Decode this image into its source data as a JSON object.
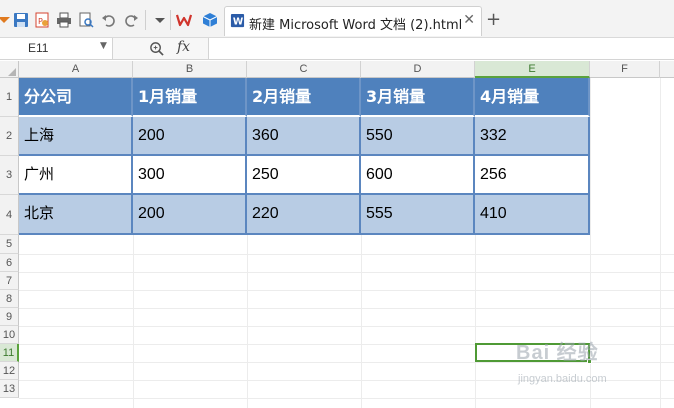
{
  "toolbar": {
    "document_tab_title": "新建 Microsoft Word 文档 (2).html",
    "close_label": "✕",
    "new_tab_label": "+"
  },
  "formula_bar": {
    "name_box": "E11",
    "fx_label": "fx",
    "formula": ""
  },
  "columns": [
    "A",
    "B",
    "C",
    "D",
    "E",
    "F"
  ],
  "rows": [
    "1",
    "2",
    "3",
    "4",
    "5",
    "6",
    "7",
    "8",
    "9",
    "10",
    "11",
    "12",
    "13"
  ],
  "active_cell": {
    "column": "E",
    "row": "11"
  },
  "table": {
    "headers": [
      "分公司",
      "1月销量",
      "2月销量",
      "3月销量",
      "4月销量"
    ],
    "rows": [
      [
        "上海",
        "200",
        "360",
        "550",
        "332"
      ],
      [
        "广州",
        "300",
        "250",
        "600",
        "256"
      ],
      [
        "北京",
        "200",
        "220",
        "555",
        "410"
      ]
    ]
  },
  "watermark": {
    "main": "Bai 经验",
    "sub": "jingyan.baidu.com"
  },
  "colors": {
    "header_fill": "#4f81bd",
    "band_fill": "#b8cce4",
    "border": "#5b86bf",
    "selection": "#4f9a35"
  },
  "icons": [
    "menu-arrow-icon",
    "save-icon",
    "pdf-export-icon",
    "print-icon",
    "print-preview-icon",
    "undo-icon",
    "redo-icon",
    "dropdown-icon",
    "wps-logo-icon",
    "cube-icon",
    "word-doc-icon",
    "zoom-icon"
  ]
}
